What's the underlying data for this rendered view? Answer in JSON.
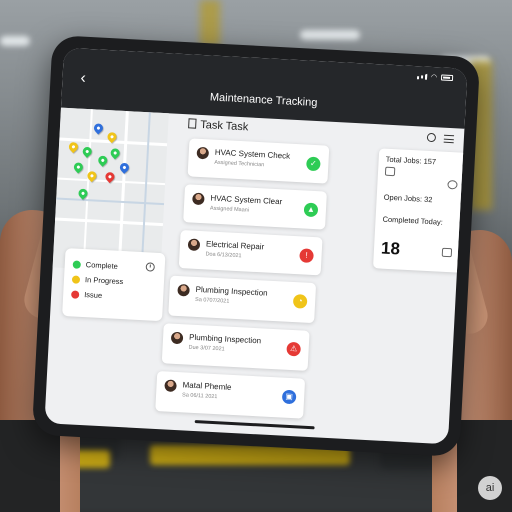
{
  "app": {
    "title": "Maintenance Tracking",
    "back_icon": "chevron-left-icon"
  },
  "topbar_icons": {
    "search": "search-icon",
    "menu": "menu-icon"
  },
  "legend": {
    "items": [
      {
        "label": "Complete",
        "color": "#2ecc55"
      },
      {
        "label": "In Progress",
        "color": "#f0c419"
      },
      {
        "label": "Issue",
        "color": "#e53935"
      }
    ]
  },
  "task_list": {
    "title": "Task Task",
    "cards": [
      {
        "name": "HVAC System Check",
        "sub": "Assigned Technician",
        "status_color": "#2ecc55",
        "status_icon": "check-icon"
      },
      {
        "name": "HVAC System Clear",
        "sub": "Assigned Maani",
        "status_color": "#2ecc55",
        "status_icon": "check-icon"
      },
      {
        "name": "Electrical Repair",
        "sub": "Doa 6/13/2021",
        "status_color": "#e53935",
        "status_icon": "alert-icon"
      },
      {
        "name": "Plumbing Inspection",
        "sub": "Sa 0707/2021",
        "status_color": "#f0c419",
        "status_icon": "progress-icon"
      },
      {
        "name": "Plumbing Inspection",
        "sub": "Due 3/07 2021",
        "status_color": "#e53935",
        "status_icon": "alert-icon"
      },
      {
        "name": "Matal Phemle",
        "sub": "Sa 06/11 2021",
        "status_color": "#2f6fdc",
        "status_icon": "info-icon"
      }
    ]
  },
  "stats": {
    "total_label": "Total Jobs: 157",
    "open_label": "Open Jobs: 32",
    "completed_label": "Completed Today:",
    "completed_value": "18"
  },
  "badge": {
    "text": "ai"
  }
}
